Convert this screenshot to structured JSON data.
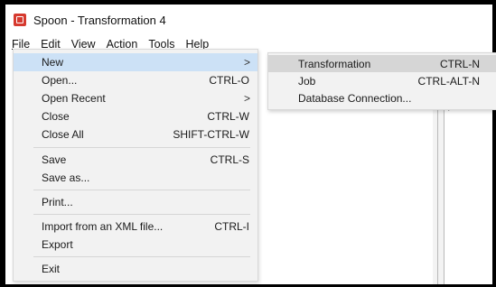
{
  "window": {
    "title": "Spoon - Transformation 4"
  },
  "menubar": {
    "file": "File",
    "edit": "Edit",
    "view": "View",
    "action": "Action",
    "tools": "Tools",
    "help": "Help"
  },
  "file_menu": {
    "items": [
      {
        "label": "New",
        "shortcut": "",
        "arrow": ">"
      },
      {
        "label": "Open...",
        "shortcut": "CTRL-O"
      },
      {
        "label": "Open Recent",
        "shortcut": "",
        "arrow": ">"
      },
      {
        "label": "Close",
        "shortcut": "CTRL-W"
      },
      {
        "label": "Close All",
        "shortcut": "SHIFT-CTRL-W"
      },
      {
        "label": "Save",
        "shortcut": "CTRL-S"
      },
      {
        "label": "Save as...",
        "shortcut": ""
      },
      {
        "label": "Print...",
        "shortcut": ""
      },
      {
        "label": "Import from an XML file...",
        "shortcut": "CTRL-I"
      },
      {
        "label": "Export",
        "shortcut": ""
      },
      {
        "label": "Exit",
        "shortcut": ""
      }
    ]
  },
  "new_submenu": {
    "items": [
      {
        "label": "Transformation",
        "shortcut": "CTRL-N"
      },
      {
        "label": "Job",
        "shortcut": "CTRL-ALT-N"
      },
      {
        "label": "Database Connection...",
        "shortcut": ""
      }
    ]
  },
  "colors": {
    "highlight": "#cce1f6",
    "menu_bg": "#f2f2f2",
    "app_icon": "#d63a2f"
  }
}
